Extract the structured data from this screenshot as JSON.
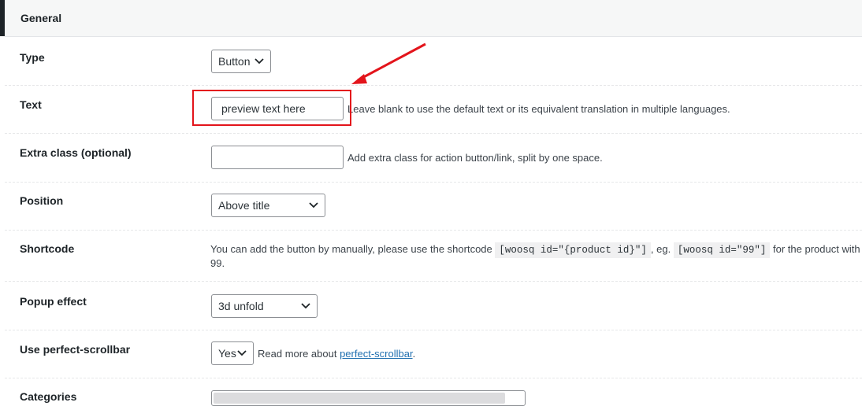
{
  "section": {
    "title": "General"
  },
  "fields": {
    "type": {
      "label": "Type",
      "value": "Button"
    },
    "text": {
      "label": "Text",
      "value": "preview text here",
      "description": "Leave blank to use the default text or its equivalent translation in multiple languages."
    },
    "extra_class": {
      "label": "Extra class (optional)",
      "value": "",
      "description": "Add extra class for action button/link, split by one space."
    },
    "position": {
      "label": "Position",
      "value": "Above title"
    },
    "shortcode": {
      "label": "Shortcode",
      "desc_before": "You can add the button by manually, please use the shortcode",
      "code1": "[woosq id=\"{product id}\"]",
      "desc_mid": ", eg.",
      "code2": "[woosq id=\"99\"]",
      "desc_after": "for the product with ID",
      "desc_line2": "99."
    },
    "popup_effect": {
      "label": "Popup effect",
      "value": "3d unfold"
    },
    "perfect_scrollbar": {
      "label": "Use perfect-scrollbar",
      "value": "Yes",
      "desc_before": "Read more about",
      "link_text": "perfect-scrollbar",
      "desc_after": "."
    },
    "categories": {
      "label": "Categories"
    }
  },
  "colors": {
    "highlight": "#e3141b",
    "link": "#2271b1",
    "header_bg": "#f6f7f7"
  },
  "icons": [
    "chevron-down-icon",
    "annotation-arrow"
  ]
}
